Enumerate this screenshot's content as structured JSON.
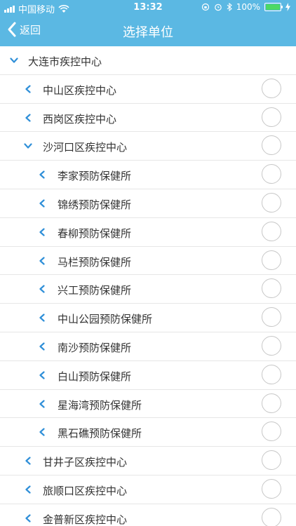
{
  "status_bar": {
    "carrier": "中国移动",
    "time": "13:32",
    "battery": "100%",
    "battery_level": 1.0
  },
  "nav": {
    "back_label": "返回",
    "title": "选择单位"
  },
  "colors": {
    "header_bg": "#5bb8e3",
    "chevron": "#2f8fd8",
    "divider": "#e6e6e6"
  },
  "tree": [
    {
      "label": "大连市疾控中心",
      "level": 0,
      "expanded": true,
      "selectable": false
    },
    {
      "label": "中山区疾控中心",
      "level": 1,
      "expanded": false,
      "selectable": true
    },
    {
      "label": "西岗区疾控中心",
      "level": 1,
      "expanded": false,
      "selectable": true
    },
    {
      "label": "沙河口区疾控中心",
      "level": 1,
      "expanded": true,
      "selectable": true
    },
    {
      "label": "李家预防保健所",
      "level": 2,
      "expanded": false,
      "selectable": true
    },
    {
      "label": "锦绣预防保健所",
      "level": 2,
      "expanded": false,
      "selectable": true
    },
    {
      "label": "春柳预防保健所",
      "level": 2,
      "expanded": false,
      "selectable": true
    },
    {
      "label": "马栏预防保健所",
      "level": 2,
      "expanded": false,
      "selectable": true
    },
    {
      "label": "兴工预防保健所",
      "level": 2,
      "expanded": false,
      "selectable": true
    },
    {
      "label": "中山公园预防保健所",
      "level": 2,
      "expanded": false,
      "selectable": true
    },
    {
      "label": "南沙预防保健所",
      "level": 2,
      "expanded": false,
      "selectable": true
    },
    {
      "label": "白山预防保健所",
      "level": 2,
      "expanded": false,
      "selectable": true
    },
    {
      "label": "星海湾预防保健所",
      "level": 2,
      "expanded": false,
      "selectable": true
    },
    {
      "label": "黑石礁预防保健所",
      "level": 2,
      "expanded": false,
      "selectable": true
    },
    {
      "label": "甘井子区疾控中心",
      "level": 1,
      "expanded": false,
      "selectable": true
    },
    {
      "label": "旅顺口区疾控中心",
      "level": 1,
      "expanded": false,
      "selectable": true
    },
    {
      "label": "金普新区疾控中心",
      "level": 1,
      "expanded": false,
      "selectable": true
    }
  ]
}
